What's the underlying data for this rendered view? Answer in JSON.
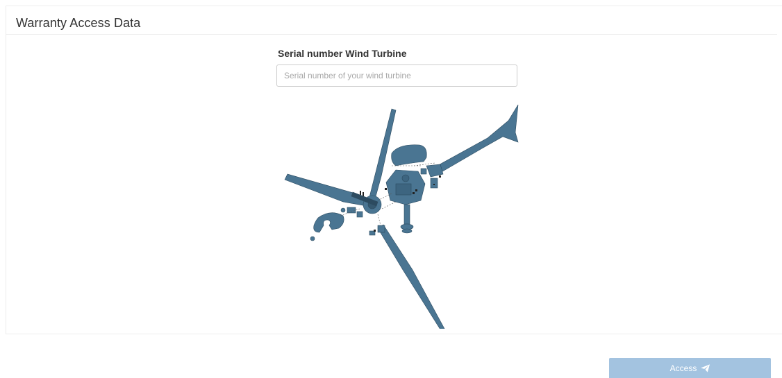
{
  "panel": {
    "title": "Warranty Access Data"
  },
  "form": {
    "serial_label": "Serial number Wind Turbine",
    "serial_placeholder": "Serial number of your wind turbine",
    "serial_value": ""
  },
  "illustration": {
    "subject": "exploded-view wind turbine",
    "color": "#4a7592"
  },
  "actions": {
    "access_label": "Access",
    "access_icon": "paper-plane-icon",
    "button_color": "#a3c3e0"
  }
}
